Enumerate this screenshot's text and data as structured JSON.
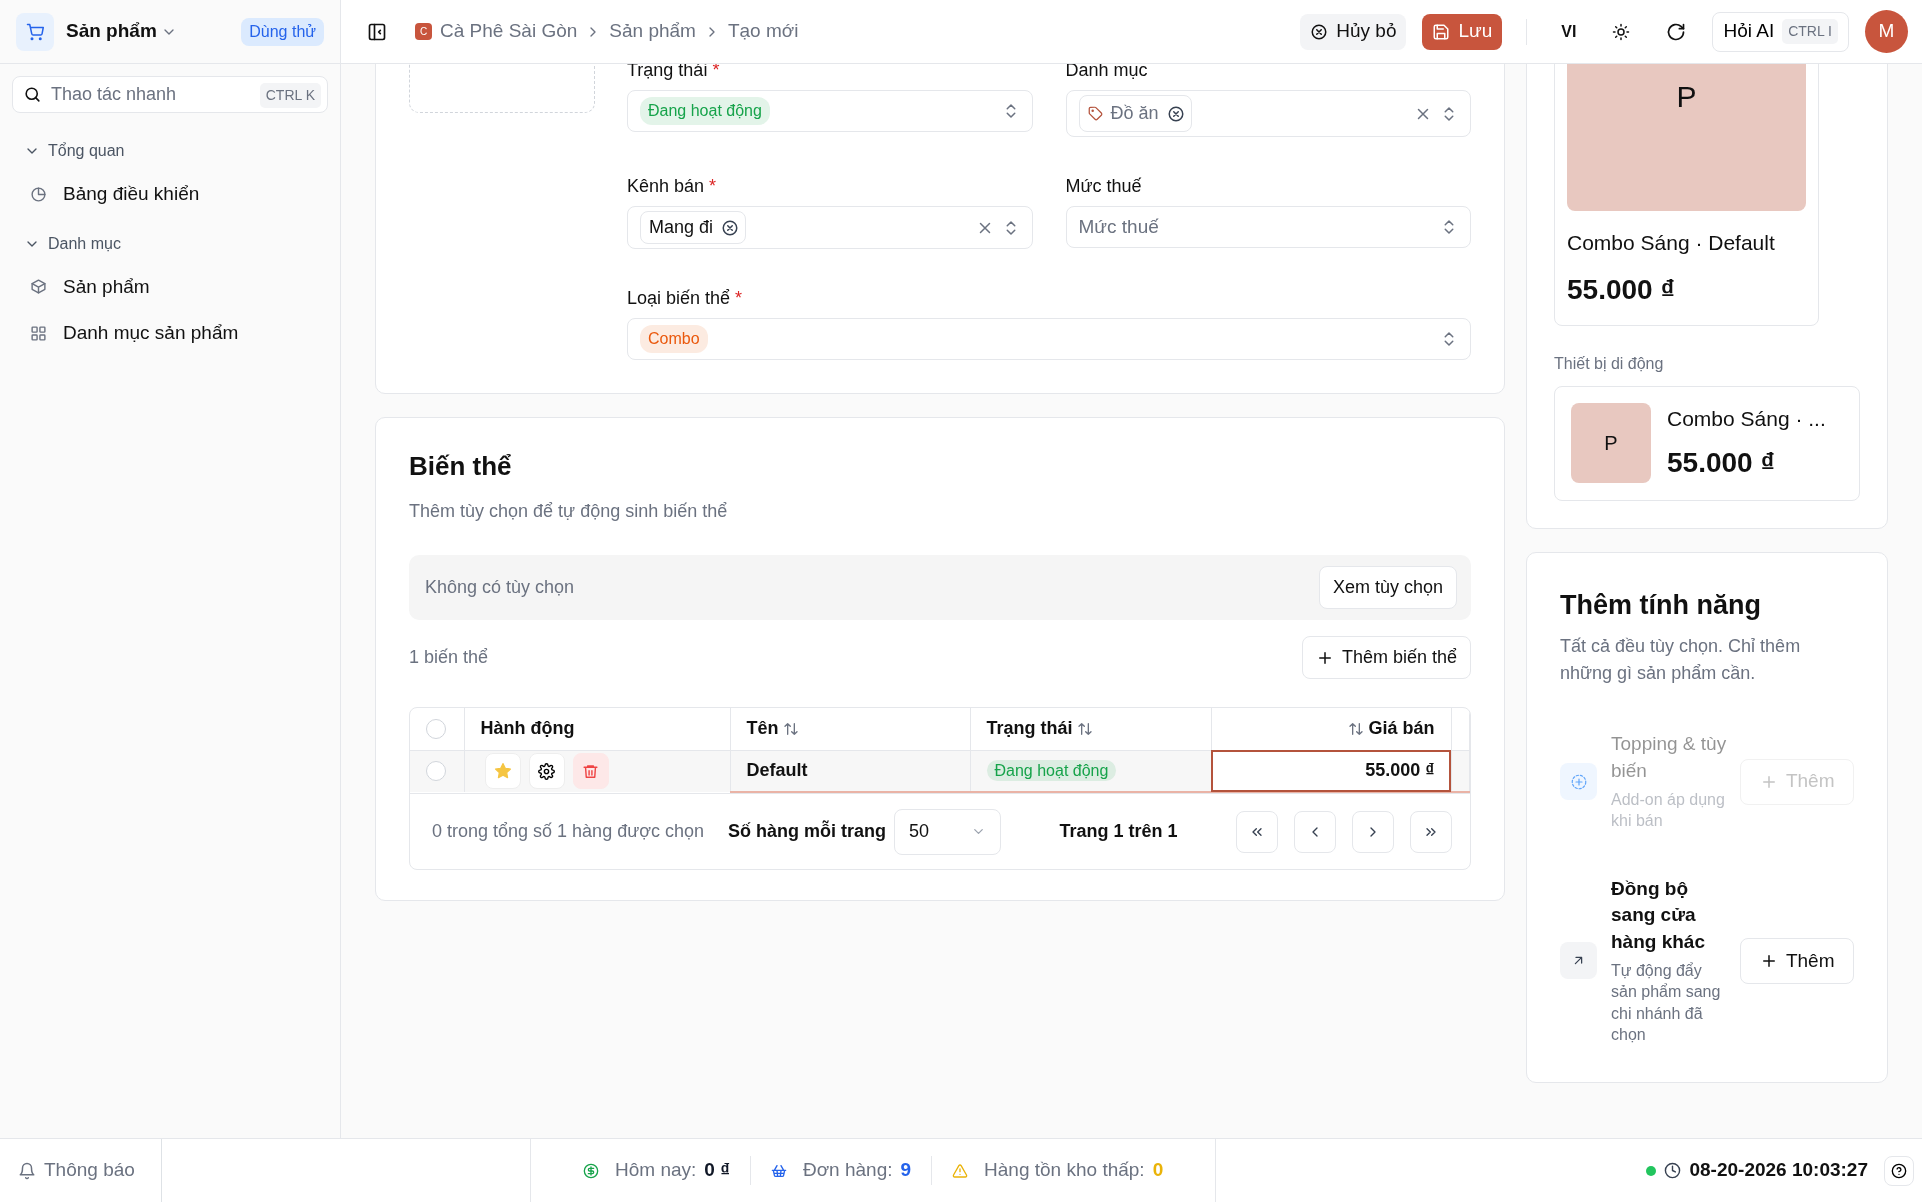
{
  "sidebar": {
    "app_title": "Sản phẩm",
    "trial_badge": "Dùng thử",
    "search": {
      "placeholder": "Thao tác nhanh",
      "shortcut": "CTRL K"
    },
    "groups": [
      {
        "label": "Tổng quan",
        "expanded": true,
        "items": [
          {
            "label": "Bảng điều khiển",
            "selected": false
          }
        ]
      },
      {
        "label": "Danh mục",
        "expanded": true,
        "items": [
          {
            "label": "Sản phẩm",
            "selected": false
          },
          {
            "label": "Danh mục sản phẩm",
            "selected": false
          }
        ]
      }
    ]
  },
  "header": {
    "breadcrumb": [
      {
        "label": "Cà Phê Sài Gòn",
        "logo_letter": "C"
      },
      {
        "label": "Sản phẩm"
      },
      {
        "label": "Tạo mới"
      }
    ],
    "cancel": "Hủy bỏ",
    "save": "Lưu",
    "language": "VI",
    "ai": {
      "label": "Hỏi AI",
      "shortcut": "CTRL I"
    },
    "avatar": "M"
  },
  "form": {
    "fields": [
      {
        "label": "Trạng thái",
        "required_mark": "*",
        "kind": "tag",
        "tag": {
          "text": "Đang hoạt động",
          "color": "#16a34a"
        },
        "clearable": false
      },
      {
        "label": "Danh mục",
        "kind": "chips",
        "chips": [
          "Đồ ăn"
        ],
        "clearable": true
      },
      {
        "label": "Kênh bán",
        "required_mark": "*",
        "kind": "chips",
        "chips": [
          "Mang đi"
        ],
        "clearable": true
      },
      {
        "label": "Mức thuế",
        "kind": "empty",
        "placeholder": "Mức thuế",
        "clearable": false
      },
      {
        "label": "Loại biến thể",
        "required_mark": "*",
        "kind": "tag",
        "tag": {
          "text": "Combo",
          "color": "#ea580c"
        },
        "clearable": false
      }
    ]
  },
  "variants": {
    "title": "Biến thể",
    "subtitle": "Thêm tùy chọn để tự động sinh biến thể",
    "options_empty": "Không có tùy chọn",
    "view_options": "Xem tùy chọn",
    "count": "1 biến thể",
    "add_variant": "Thêm biến thể",
    "table": {
      "all_checked": false,
      "columns": [
        {
          "label": "Hành động",
          "sortable": false
        },
        {
          "label": "Tên",
          "sortable": true
        },
        {
          "label": "Trạng thái",
          "sortable": true
        },
        {
          "label": "Giá bán",
          "sortable": true
        }
      ],
      "rows": [
        {
          "checked": false,
          "starred": true,
          "name": "Default",
          "status": {
            "text": "Đang hoạt động",
            "color": "#16a34a"
          },
          "price": "55.000 ₫",
          "focused": true
        }
      ]
    },
    "footer": {
      "selection": "0 trong tổng số 1 hàng được chọn",
      "rows_per_page_label": "Số hàng mỗi trang",
      "rows_per_page": "50",
      "page": "Trang 1 trên 1"
    }
  },
  "preview": {
    "desktop": {
      "image_letter": "P",
      "name": "Combo Sáng · Default",
      "price": "55.000 ₫"
    },
    "mobile_label": "Thiết bị di động",
    "mobile": {
      "image_letter": "P",
      "name": "Combo Sáng · ...",
      "price": "55.000 ₫"
    }
  },
  "features": {
    "title": "Thêm tính năng",
    "subtitle": "Tất cả đều tùy chọn. Chỉ thêm những gì sản phẩm cần.",
    "items": [
      {
        "title": "Topping & tùy biến",
        "description": "Add-on áp dụng khi bán",
        "button": "Thêm",
        "disabled": true
      },
      {
        "title": "Đồng bộ sang cửa hàng khác",
        "description": "Tự động đẩy sản phẩm sang chi nhánh đã chọn",
        "button": "Thêm",
        "disabled": false
      }
    ]
  },
  "status_bar": {
    "notifications": "Thông báo",
    "stats": [
      {
        "label": "Hôm nay:",
        "value": "0 ₫",
        "color": "#111827"
      },
      {
        "label": "Đơn hàng:",
        "value": "9",
        "color": "#2563eb"
      },
      {
        "label": "Hàng tồn kho thấp:",
        "value": "0",
        "color": "#eab308"
      }
    ],
    "online": true,
    "time": "08-20-2026 10:03:27"
  }
}
